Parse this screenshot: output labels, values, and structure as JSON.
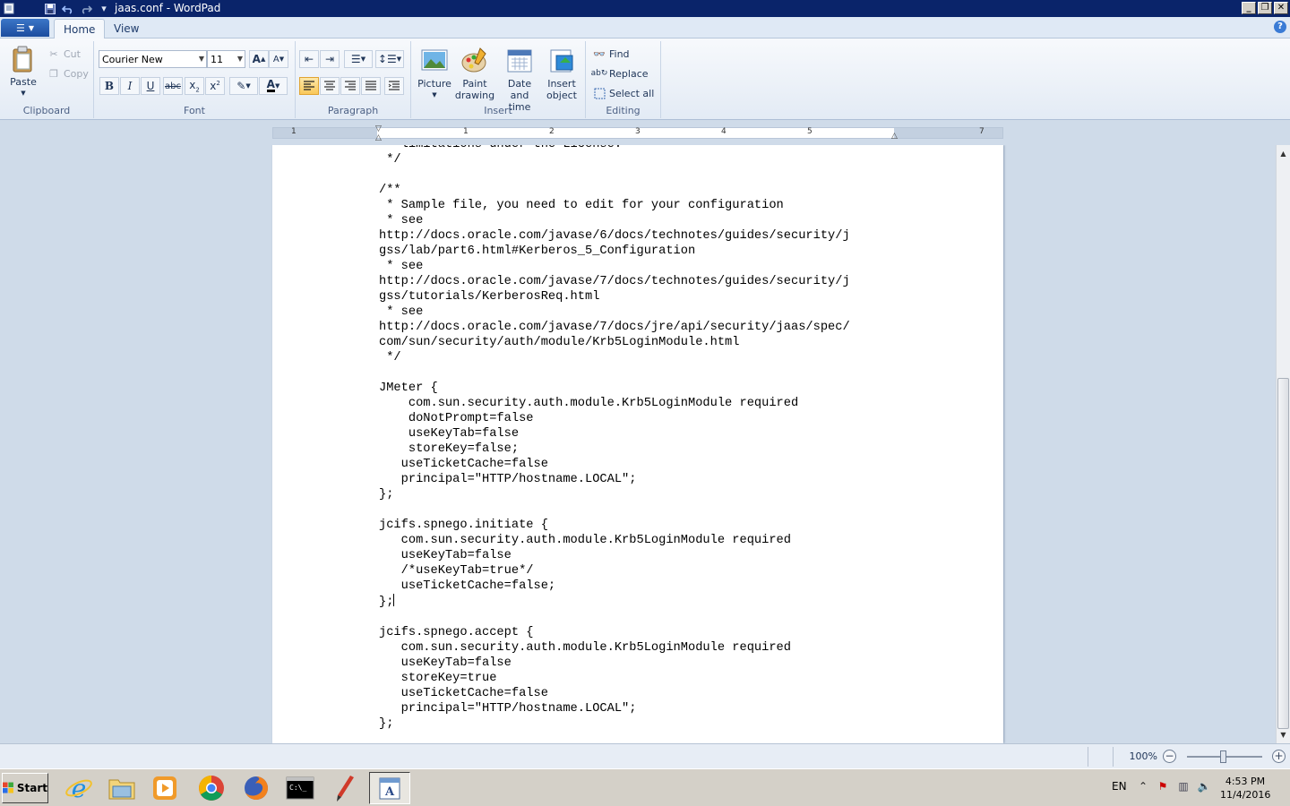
{
  "window": {
    "title": "jaas.conf - WordPad"
  },
  "tabs": {
    "file_label": "",
    "home": "Home",
    "view": "View"
  },
  "clipboard": {
    "paste": "Paste",
    "cut": "Cut",
    "copy": "Copy",
    "group_label": "Clipboard"
  },
  "font": {
    "family": "Courier New",
    "size": "11",
    "group_label": "Font"
  },
  "paragraph": {
    "group_label": "Paragraph"
  },
  "insert": {
    "picture": "Picture",
    "paint_drawing_1": "Paint",
    "paint_drawing_2": "drawing",
    "date_time_1": "Date and",
    "date_time_2": "time",
    "insert_object_1": "Insert",
    "insert_object_2": "object",
    "group_label": "Insert"
  },
  "editing": {
    "find": "Find",
    "replace": "Replace",
    "select_all": "Select all",
    "group_label": "Editing"
  },
  "ruler": {
    "numbers": [
      "1",
      "1",
      "2",
      "3",
      "4",
      "5",
      "7"
    ]
  },
  "document": {
    "lines": [
      "   limitations under the License.",
      " */",
      "",
      "/**",
      " * Sample file, you need to edit for your configuration",
      " * see",
      "http://docs.oracle.com/javase/6/docs/technotes/guides/security/j",
      "gss/lab/part6.html#Kerberos_5_Configuration",
      " * see",
      "http://docs.oracle.com/javase/7/docs/technotes/guides/security/j",
      "gss/tutorials/KerberosReq.html",
      " * see",
      "http://docs.oracle.com/javase/7/docs/jre/api/security/jaas/spec/",
      "com/sun/security/auth/module/Krb5LoginModule.html",
      " */",
      "",
      "JMeter {",
      "    com.sun.security.auth.module.Krb5LoginModule required",
      "    doNotPrompt=false",
      "    useKeyTab=false",
      "    storeKey=false;",
      "   useTicketCache=false",
      "   principal=\"HTTP/hostname.LOCAL\";",
      "};",
      "",
      "jcifs.spnego.initiate {",
      "   com.sun.security.auth.module.Krb5LoginModule required",
      "   useKeyTab=false",
      "   /*useKeyTab=true*/",
      "   useTicketCache=false;",
      "};",
      "",
      "jcifs.spnego.accept {",
      "   com.sun.security.auth.module.Krb5LoginModule required",
      "   useKeyTab=false",
      "   storeKey=true",
      "   useTicketCache=false",
      "   principal=\"HTTP/hostname.LOCAL\";",
      "};"
    ],
    "caret_line": 30
  },
  "statusbar": {
    "zoom": "100%",
    "zoom_out": "−",
    "zoom_in": "+"
  },
  "taskbar": {
    "start": "Start",
    "language": "EN",
    "time": "4:53 PM",
    "date": "11/4/2016",
    "apps": [
      "internet-explorer-icon",
      "file-explorer-icon",
      "media-player-icon",
      "chrome-icon",
      "firefox-icon",
      "command-prompt-icon",
      "paint-brush-icon",
      "wordpad-icon"
    ]
  },
  "colors": {
    "titlebar": "#0a246a",
    "workspace": "#cfdbe9",
    "active_button": "#f9c85a"
  }
}
